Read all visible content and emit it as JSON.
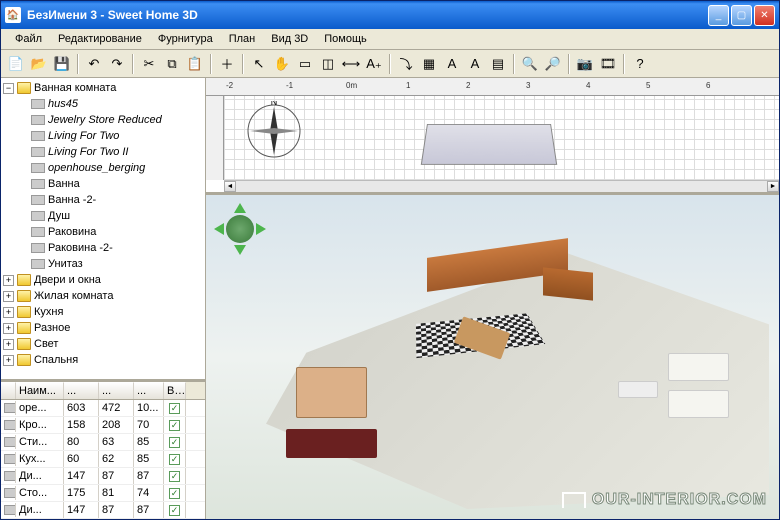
{
  "window": {
    "title": "БезИмени 3 - Sweet Home 3D"
  },
  "menu": {
    "items": [
      "Файл",
      "Редактирование",
      "Фурнитура",
      "План",
      "Вид 3D",
      "Помощь"
    ]
  },
  "toolbar": {
    "groups": [
      [
        "new-file-icon",
        "open-icon",
        "save-icon"
      ],
      [
        "undo-icon",
        "redo-icon"
      ],
      [
        "cut-icon",
        "copy-icon",
        "paste-icon"
      ],
      [
        "add-furniture-icon"
      ],
      [
        "select-icon",
        "pan-icon",
        "wall-icon",
        "room-icon",
        "dimension-icon",
        "text-icon"
      ],
      [
        "import-icon",
        "texture-icon",
        "a1-icon",
        "a2-icon",
        "grid-icon"
      ],
      [
        "zoom-in-icon",
        "zoom-out-icon"
      ],
      [
        "photo-icon",
        "video-icon"
      ],
      [
        "help-icon"
      ]
    ]
  },
  "catalog": {
    "root": {
      "label": "Ванная комната",
      "expanded": true
    },
    "items": [
      {
        "label": "hus45",
        "italic": true
      },
      {
        "label": "Jewelry Store Reduced",
        "italic": true
      },
      {
        "label": "Living For Two",
        "italic": true
      },
      {
        "label": "Living For Two II",
        "italic": true
      },
      {
        "label": "openhouse_berging",
        "italic": true
      },
      {
        "label": "Ванна",
        "italic": false
      },
      {
        "label": "Ванна -2-",
        "italic": false
      },
      {
        "label": "Душ",
        "italic": false
      },
      {
        "label": "Раковина",
        "italic": false
      },
      {
        "label": "Раковина -2-",
        "italic": false
      },
      {
        "label": "Унитаз",
        "italic": false
      }
    ],
    "siblings": [
      "Двери и окна",
      "Жилая комната",
      "Кухня",
      "Разное",
      "Свет",
      "Спальня"
    ]
  },
  "furnitureTable": {
    "headers": [
      "",
      "Наим...",
      "...",
      "...",
      "...",
      "В..."
    ],
    "rows": [
      {
        "name": "оре...",
        "w": "603",
        "d": "472",
        "h": "10...",
        "vis": true
      },
      {
        "name": "Кро...",
        "w": "158",
        "d": "208",
        "h": "70",
        "vis": true
      },
      {
        "name": "Сти...",
        "w": "80",
        "d": "63",
        "h": "85",
        "vis": true
      },
      {
        "name": "Кух...",
        "w": "60",
        "d": "62",
        "h": "85",
        "vis": true
      },
      {
        "name": "Ди...",
        "w": "147",
        "d": "87",
        "h": "87",
        "vis": true
      },
      {
        "name": "Сто...",
        "w": "175",
        "d": "81",
        "h": "74",
        "vis": true
      },
      {
        "name": "Ди...",
        "w": "147",
        "d": "87",
        "h": "87",
        "vis": true
      }
    ]
  },
  "plan": {
    "rulerMarks": [
      "-2",
      "-1",
      "0m",
      "1",
      "2",
      "3",
      "4",
      "5",
      "6"
    ],
    "compassLabel": "N"
  },
  "watermark": "OUR-INTERIOR.COM"
}
